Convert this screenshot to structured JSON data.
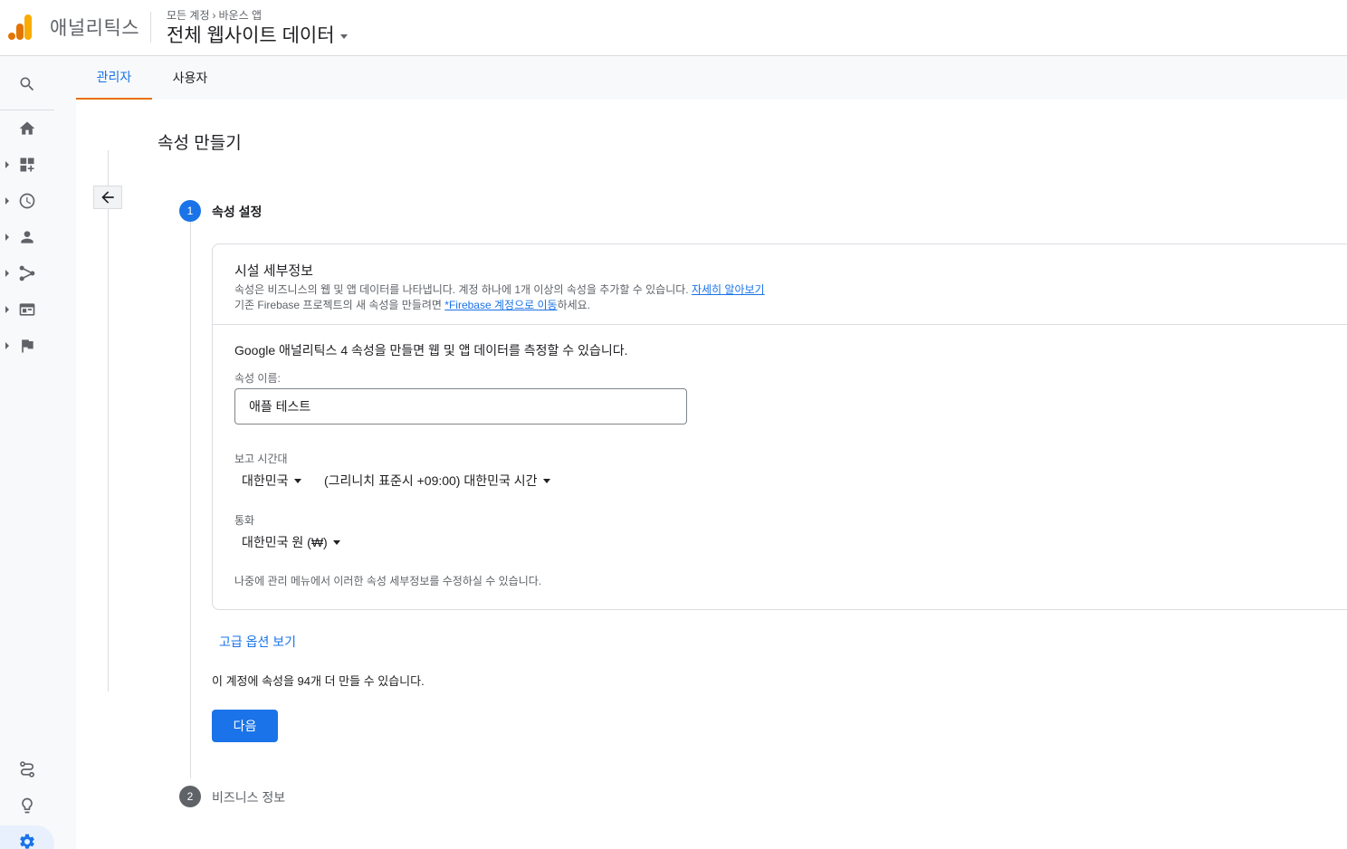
{
  "header": {
    "product_name": "애널리틱스",
    "breadcrumb": {
      "account": "모든 계정",
      "separator": "›",
      "property": "바운스 앱"
    },
    "view_title": "전체 웹사이트 데이터"
  },
  "rail": {
    "items": [
      "search-icon",
      "home-icon",
      "customization-icon",
      "realtime-icon",
      "audience-icon",
      "acquisition-icon",
      "behavior-icon",
      "conversions-icon"
    ],
    "bottom": [
      "attribution-icon",
      "discover-icon",
      "admin-gear-icon"
    ]
  },
  "tabs": [
    {
      "label": "관리자",
      "active": true
    },
    {
      "label": "사용자",
      "active": false
    }
  ],
  "page": {
    "title": "속성 만들기"
  },
  "steps": [
    {
      "number": "1",
      "label": "속성 설정"
    },
    {
      "number": "2",
      "label": "비즈니스 정보"
    }
  ],
  "card": {
    "heading": "시설 세부정보",
    "desc1_text": "속성은 비즈니스의 웹 및 앱 데이터를 나타냅니다. 계정 하나에 1개 이상의 속성을 추가할 수 있습니다. ",
    "desc1_link": "자세히 알아보기",
    "desc2_prefix": "기존 Firebase 프로젝트의 새 속성을 만들려면 ",
    "desc2_link": "*Firebase 계정으로 이동",
    "desc2_suffix": "하세요.",
    "intro": "Google 애널리틱스 4 속성을 만들면 웹 및 앱 데이터를 측정할 수 있습니다.",
    "property_name_label": "속성 이름:",
    "property_name_value": "애플 테스트",
    "timezone_label": "보고 시간대",
    "country_value": "대한민국",
    "timezone_value": "(그리니치 표준시 +09:00) 대한민국 시간",
    "currency_label": "통화",
    "currency_value": "대한민국 원 (₩)",
    "note": "나중에 관리 메뉴에서 이러한 속성 세부정보를 수정하실 수 있습니다."
  },
  "advanced_link": "고급 옵션 보기",
  "quota_text": "이 계정에 속성을 94개 더 만들 수 있습니다.",
  "next_button": "다음",
  "colors": {
    "accent": "#1a73e8",
    "tab_underline": "#e8710a",
    "logo_orange": "#f9ab00",
    "logo_dark_orange": "#e37400"
  }
}
